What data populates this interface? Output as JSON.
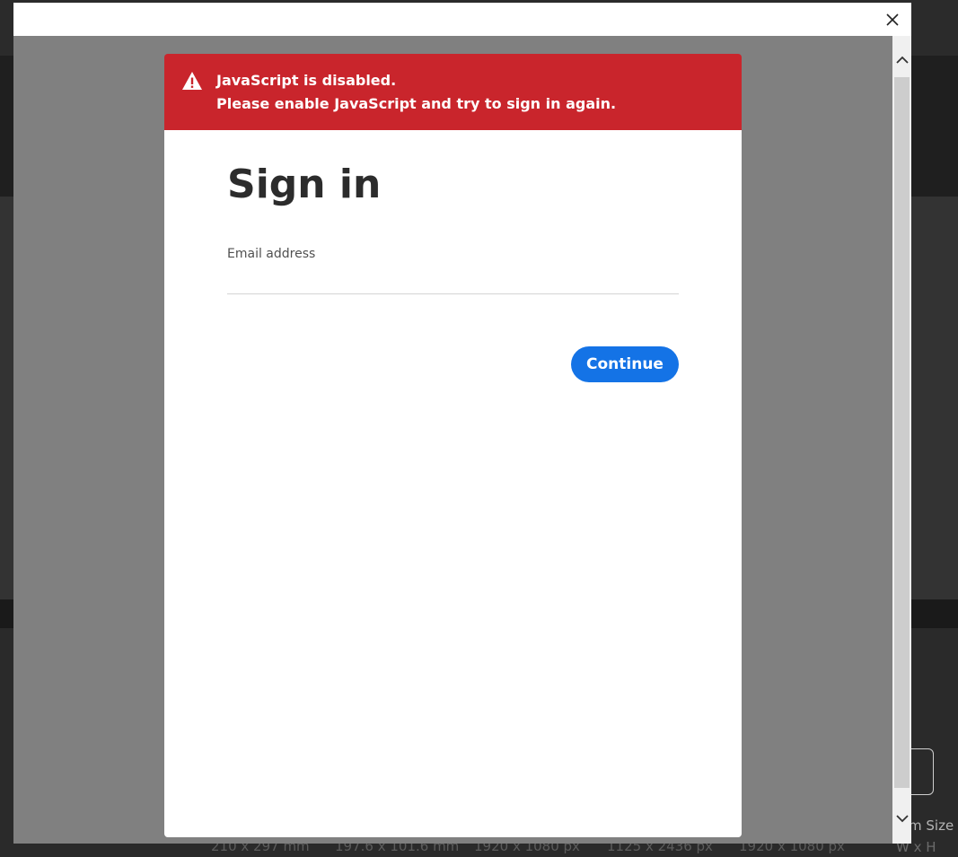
{
  "alert": {
    "line1": "JavaScript is disabled.",
    "line2": "Please enable JavaScript and try to sign in again.",
    "icon": "warning-icon"
  },
  "signin": {
    "title": "Sign in",
    "email_label": "Email address",
    "email_value": "",
    "continue_label": "Continue"
  },
  "background": {
    "sizes": [
      "210 x 297 mm",
      "197.6 x 101.6 mm",
      "1920 x 1080 px",
      "1125 x 2436 px",
      "1920 x 1080 px"
    ],
    "custom_label": "m Size",
    "custom_sub": "W x H"
  },
  "colors": {
    "alert": "#c9252c",
    "primary_button": "#1473e6",
    "overlay": "#808080"
  }
}
